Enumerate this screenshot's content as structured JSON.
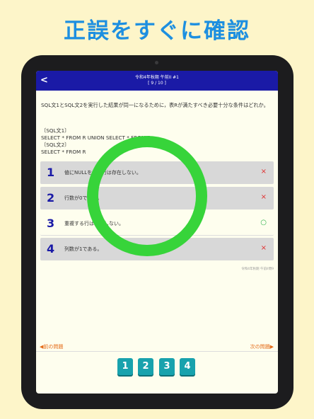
{
  "headline": "正誤をすぐに確認",
  "navbar": {
    "back": "<",
    "title": "令和4年秋期 午前II #1",
    "progress": "[ 9 / 10 ]"
  },
  "question": {
    "text": "SQL文1とSQL文2を実行した結果が同一になるために，表Rが満たすべき必要十分な条件はどれか。",
    "sql1_label": "〔SQL文1〕",
    "sql1": "SELECT * FROM R UNION SELECT * FROM R",
    "sql2_label": "〔SQL文2〕",
    "sql2": "SELECT * FROM R"
  },
  "choices": [
    {
      "num": "1",
      "text": "値にNULLをもつ行は存在しない。",
      "mark": "×"
    },
    {
      "num": "2",
      "text": "行数が0である。",
      "mark": "×"
    },
    {
      "num": "3",
      "text": "重複する行は存在しない。",
      "mark": "○"
    },
    {
      "num": "4",
      "text": "列数が1である。",
      "mark": "×"
    }
  ],
  "source": "令和4年秋期 午前II問9",
  "nav": {
    "prev": "◀前の問題",
    "next": "次の問題▶"
  },
  "answer_buttons": [
    "1",
    "2",
    "3",
    "4"
  ],
  "colors": {
    "accent": "#1a1aa6",
    "headline": "#1d8fe0",
    "correct": "#37d43a",
    "wrong": "#e03030",
    "answer": "#18a2ad"
  }
}
